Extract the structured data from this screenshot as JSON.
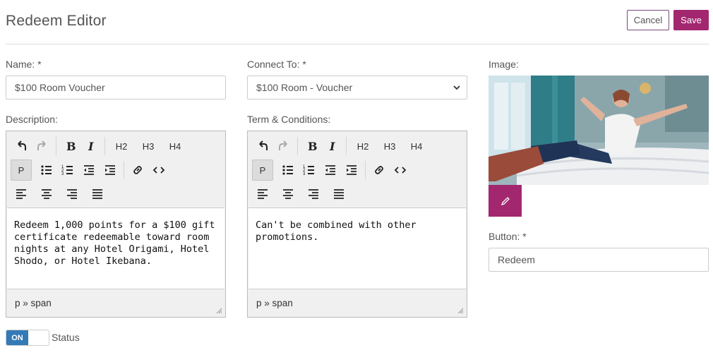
{
  "page": {
    "title": "Redeem Editor"
  },
  "actions": {
    "cancel_label": "Cancel",
    "save_label": "Save",
    "accent": "#a3276f"
  },
  "fields": {
    "name": {
      "label": "Name: *",
      "value": "$100 Room Voucher"
    },
    "connect_to": {
      "label": "Connect To: *",
      "value": "$100 Room - Voucher"
    },
    "image": {
      "label": "Image:"
    },
    "button": {
      "label": "Button: *",
      "value": "Redeem"
    }
  },
  "description": {
    "label": "Description:",
    "content": "Redeem 1,000 points for a $100 gift certificate redeemable toward room nights at any Hotel Origami, Hotel Shodo, or Hotel Ikebana.",
    "statusbar": "p » span"
  },
  "terms": {
    "label": "Term & Conditions:",
    "content": "Can't be combined with other promotions.",
    "statusbar": "p » span"
  },
  "toolbar": {
    "h2": "H2",
    "h3": "H3",
    "h4": "H4",
    "paragraph": "P"
  },
  "status_toggle": {
    "on_label": "ON",
    "label": "Status",
    "on_color": "#337ab7"
  }
}
